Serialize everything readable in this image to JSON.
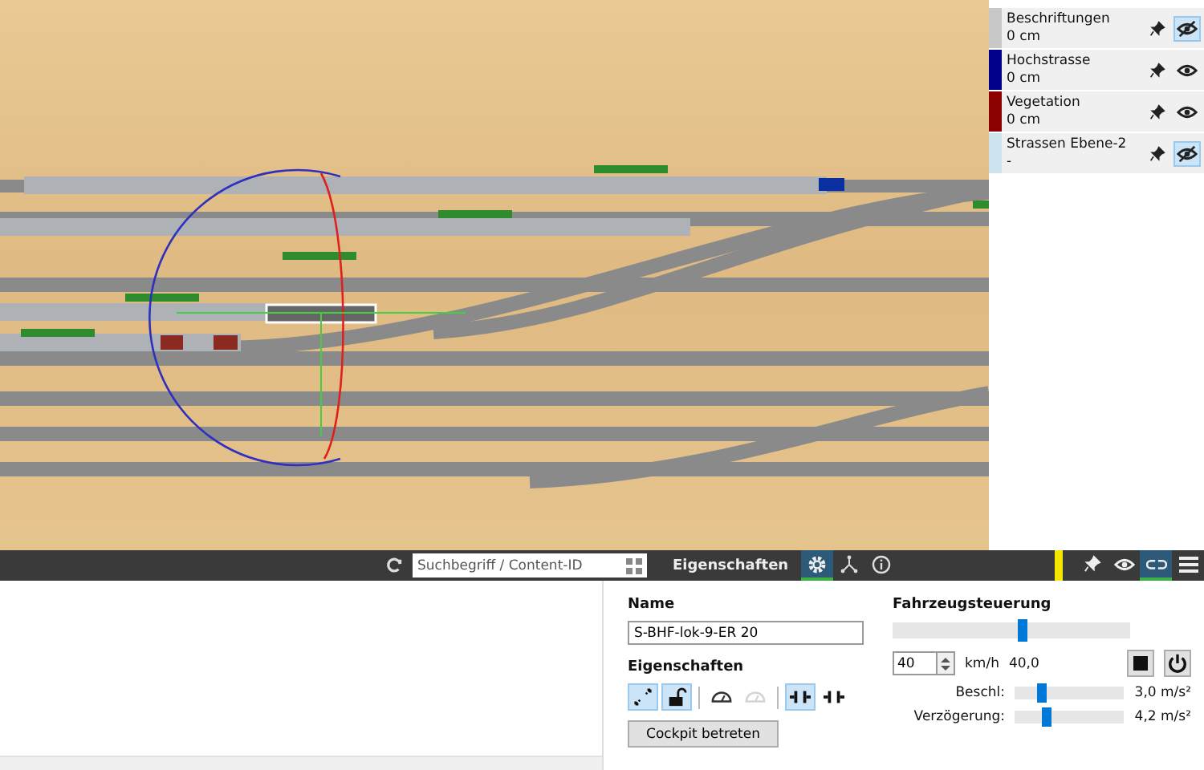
{
  "layers": [
    {
      "name": "Beschriftungen",
      "value": "0 cm",
      "color": "#c8c8c8",
      "hidden": true
    },
    {
      "name": "Hochstrasse",
      "value": "0 cm",
      "color": "#00008b",
      "hidden": false
    },
    {
      "name": "Vegetation",
      "value": "0 cm",
      "color": "#8b0000",
      "hidden": false
    },
    {
      "name": "Strassen Ebene-2",
      "value": "-",
      "color": "#cde3ee",
      "hidden": true
    }
  ],
  "toolbar": {
    "search": {
      "placeholder": "Suchbegriff / Content-ID"
    },
    "panel_title": "Eigenschaften",
    "tabs": [
      {
        "kind": "gear",
        "selected": true
      },
      {
        "kind": "network",
        "selected": false
      },
      {
        "kind": "info",
        "selected": false
      }
    ],
    "right_tools": [
      {
        "kind": "pin",
        "selected": false
      },
      {
        "kind": "eye",
        "selected": false
      },
      {
        "kind": "link",
        "selected": true
      },
      {
        "kind": "menu",
        "selected": false
      }
    ]
  },
  "properties": {
    "name_label": "Name",
    "name_value": "S-BHF-lok-9-ER 20",
    "props_label": "Eigenschaften",
    "prop_buttons": [
      {
        "kind": "expand",
        "on": true,
        "disabled": false
      },
      {
        "kind": "lock",
        "on": true,
        "disabled": false
      },
      {
        "kind": "gauge",
        "on": false,
        "disabled": false
      },
      {
        "kind": "gauge",
        "on": false,
        "disabled": true
      },
      {
        "kind": "coupler",
        "on": true,
        "disabled": false
      },
      {
        "kind": "coupler",
        "on": false,
        "disabled": false
      }
    ],
    "cockpit_button": "Cockpit betreten"
  },
  "control": {
    "title": "Fahrzeugsteuerung",
    "speed_slider": {
      "level": 0.55
    },
    "speed_input": "40",
    "unit": "km/h",
    "speed_reading": "40,0",
    "sliders": [
      {
        "label": "Beschl:",
        "level": 0.25,
        "reading": "3,0 m/s²"
      },
      {
        "label": "Verzögerung:",
        "level": 0.3,
        "reading": "4,2 m/s²"
      }
    ]
  }
}
